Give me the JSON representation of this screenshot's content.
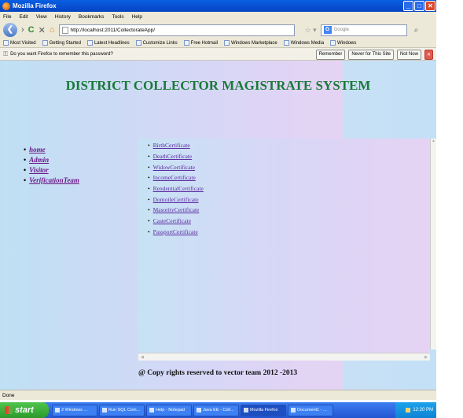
{
  "window": {
    "title": "Mozilla Firefox"
  },
  "menu": [
    "File",
    "Edit",
    "View",
    "History",
    "Bookmarks",
    "Tools",
    "Help"
  ],
  "nav": {
    "url": "http://localhost:2011/CollectorateApp/",
    "search_placeholder": "Google"
  },
  "bookmarks": [
    "Most Visited",
    "Getting Started",
    "Latest Headlines",
    "Customize Links",
    "Free Hotmail",
    "Windows Marketplace",
    "Windows Media",
    "Windows"
  ],
  "notification": {
    "text": "Do you want Firefox to remember this password?",
    "remember": "Remember",
    "never": "Never for This Site",
    "not_now": "Not Now"
  },
  "page": {
    "heading": "DISTRICT COLLECTOR MAGISTRATE SYSTEM",
    "left_nav": [
      "home",
      "Admin",
      "Visitor",
      "VerificationTeam"
    ],
    "certificates": [
      "BirthCertificate",
      "DeathCertificate",
      "WidowCertificate",
      "IncomeCertificate",
      "RendentialCertificate",
      "DomoileCertificate",
      "MasorityCertificate",
      "CasteCertificate",
      "PassportCertificate"
    ],
    "footer": "@ Copy rights reserved to vector team 2012 -2013"
  },
  "status": "Done",
  "taskbar": {
    "start": "start",
    "tasks": [
      "2 Windows ...",
      "Run SQL Com...",
      "Help - Notepad",
      "Java EE - Coll...",
      "Mozilla Firefox",
      "Document1 - ..."
    ],
    "time": "12:20 PM"
  }
}
